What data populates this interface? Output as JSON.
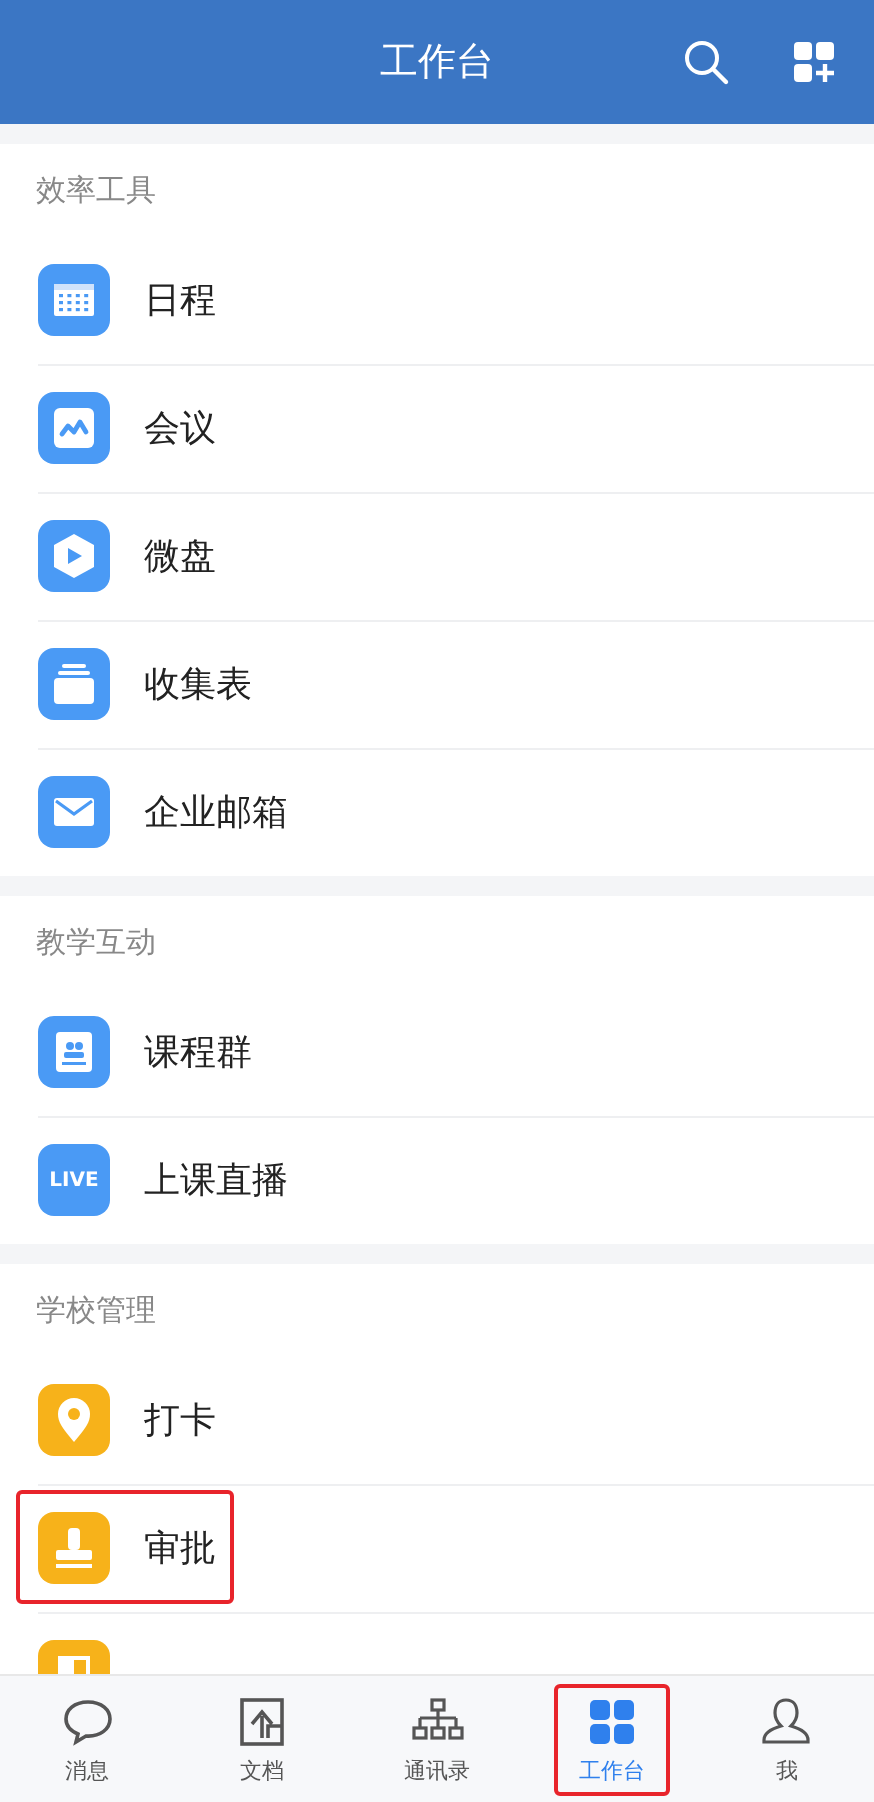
{
  "header": {
    "title": "工作台"
  },
  "sections": [
    {
      "title": "效率工具",
      "items": [
        {
          "label": "日程",
          "kind": "calendar",
          "color": "#4a9af5",
          "highlighted": false
        },
        {
          "label": "会议",
          "kind": "meeting",
          "color": "#4a9af5",
          "highlighted": false
        },
        {
          "label": "微盘",
          "kind": "disk",
          "color": "#4a9af5",
          "highlighted": false
        },
        {
          "label": "收集表",
          "kind": "stack",
          "color": "#4a9af5",
          "highlighted": false
        },
        {
          "label": "企业邮箱",
          "kind": "mail",
          "color": "#4a9af5",
          "highlighted": false
        }
      ]
    },
    {
      "title": "教学互动",
      "items": [
        {
          "label": "课程群",
          "kind": "book",
          "color": "#4a9af5",
          "highlighted": false
        },
        {
          "label": "上课直播",
          "kind": "live",
          "icon_text": "LIVE",
          "color": "#4a9af5",
          "highlighted": false
        }
      ]
    },
    {
      "title": "学校管理",
      "items": [
        {
          "label": "打卡",
          "kind": "pin",
          "color": "#f7b21a",
          "highlighted": false
        },
        {
          "label": "审批",
          "kind": "stamp",
          "color": "#f7b21a",
          "highlighted": true
        },
        {
          "kind": "door",
          "color": "#f7b21a",
          "highlighted": false
        }
      ]
    }
  ],
  "tabs": [
    {
      "label": "消息",
      "kind": "chat",
      "selected": false,
      "highlighted": false
    },
    {
      "label": "文档",
      "kind": "doc",
      "selected": false,
      "highlighted": false
    },
    {
      "label": "通讯录",
      "kind": "org",
      "selected": false,
      "highlighted": false
    },
    {
      "label": "工作台",
      "kind": "grid",
      "selected": true,
      "highlighted": true
    },
    {
      "label": "我",
      "kind": "person",
      "selected": false,
      "highlighted": false
    }
  ]
}
